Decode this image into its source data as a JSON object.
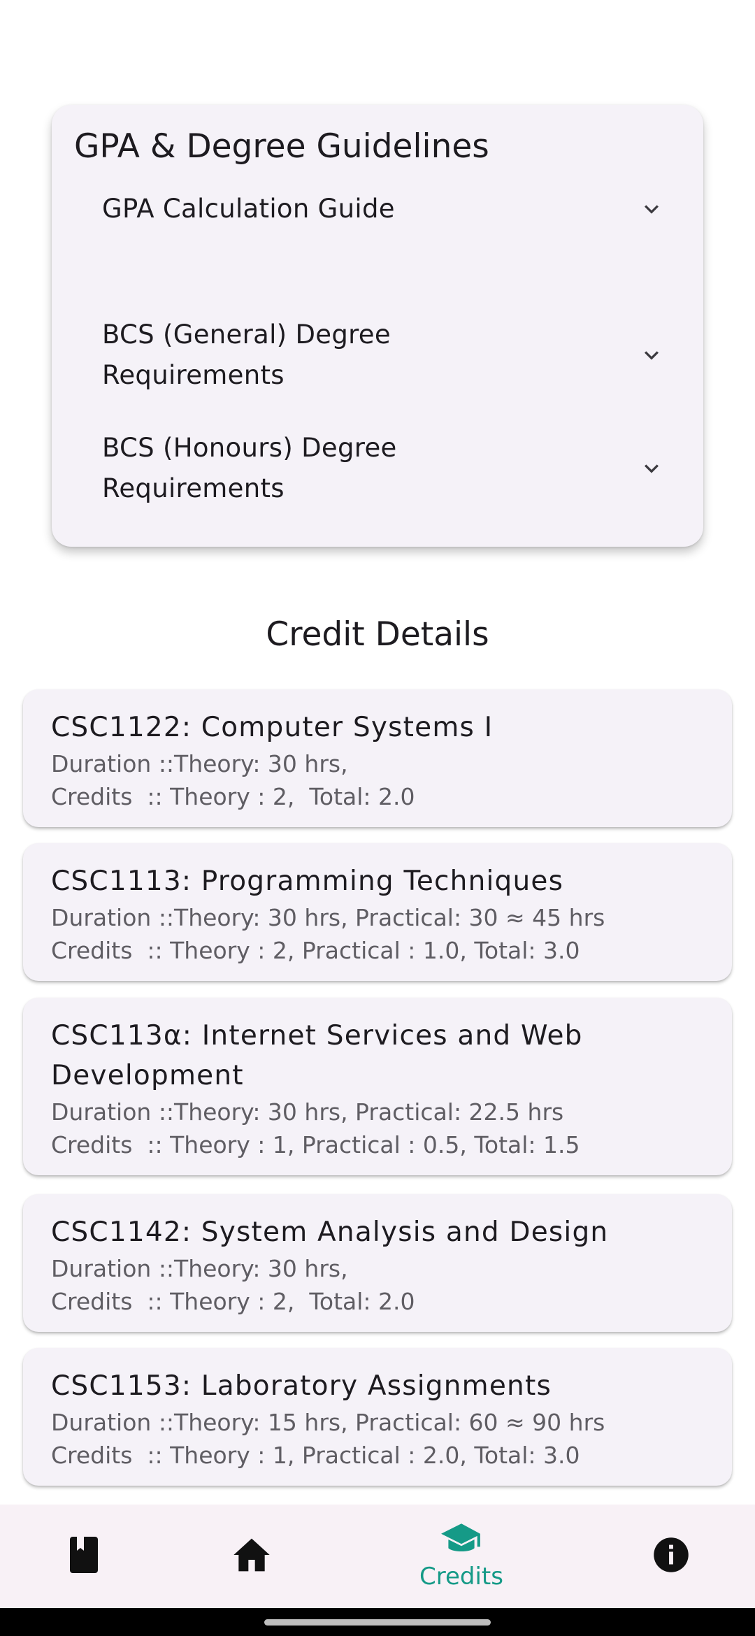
{
  "guidelines": {
    "title": "GPA & Degree Guidelines",
    "items": [
      {
        "label": "GPA Calculation Guide"
      },
      {
        "label": "BCS (General) Degree Requirements"
      },
      {
        "label": "BCS (Honours) Degree Requirements"
      }
    ]
  },
  "credit_details": {
    "title": "Credit Details",
    "courses": [
      {
        "title": "CSC1122: Computer Systems I",
        "duration": "Duration ::Theory: 30 hrs,",
        "credits": "Credits  :: Theory : 2,  Total: 2.0"
      },
      {
        "title": "CSC1113: Programming Techniques",
        "duration": "Duration ::Theory: 30 hrs, Practical: 30 ≈ 45 hrs",
        "credits": "Credits  :: Theory : 2, Practical : 1.0, Total: 3.0"
      },
      {
        "title": "CSC113α:  Internet Services and Web Development",
        "duration": "Duration ::Theory: 30 hrs, Practical: 22.5 hrs",
        "credits": "Credits  :: Theory : 1, Practical : 0.5, Total: 1.5"
      },
      {
        "title": "CSC1142: System Analysis and Design",
        "duration": "Duration ::Theory: 30 hrs,",
        "credits": "Credits  :: Theory : 2,  Total: 2.0"
      },
      {
        "title": "CSC1153: Laboratory Assignments",
        "duration": "Duration ::Theory: 15 hrs, Practical: 60 ≈ 90 hrs",
        "credits": "Credits  :: Theory : 1, Practical : 2.0, Total: 3.0"
      }
    ]
  },
  "bottom_nav": {
    "items": [
      {
        "icon": "book-icon",
        "label": ""
      },
      {
        "icon": "home-icon",
        "label": ""
      },
      {
        "icon": "graduation-cap-icon",
        "label": "Credits",
        "active": true
      },
      {
        "icon": "info-icon",
        "label": ""
      }
    ]
  },
  "colors": {
    "accent": "#159a87",
    "card_background": "#f5f2f8",
    "nav_background": "#f8f1f6"
  }
}
